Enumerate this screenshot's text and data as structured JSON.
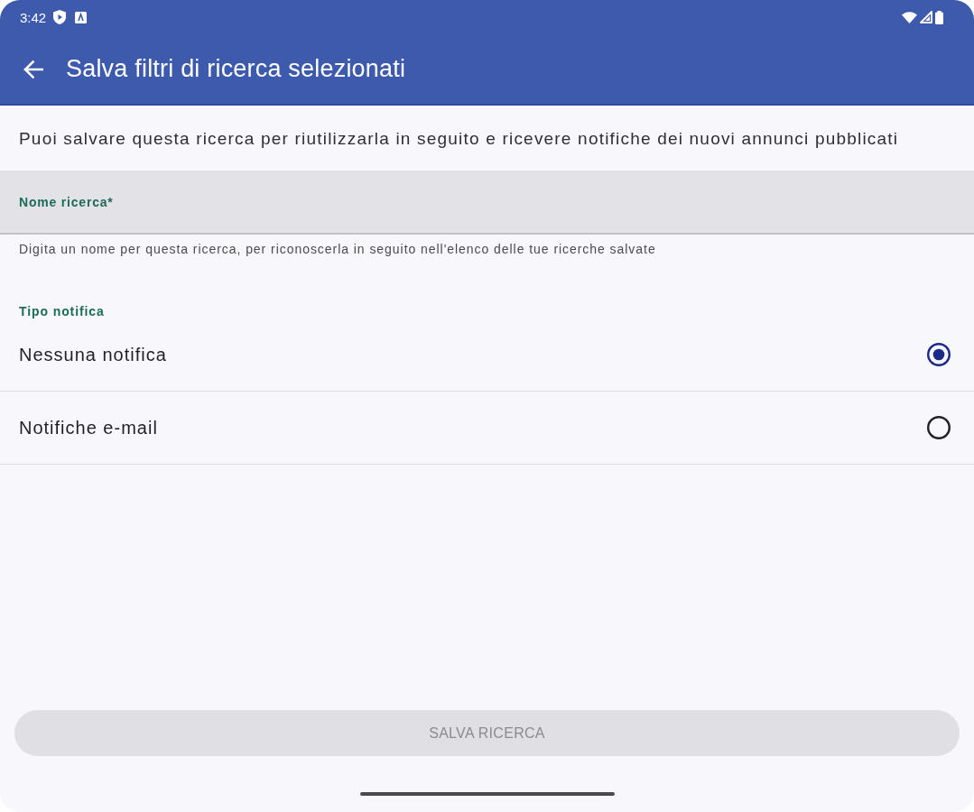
{
  "status_bar": {
    "time": "3:42"
  },
  "app_bar": {
    "title": "Salva filtri di ricerca selezionati"
  },
  "intro": "Puoi salvare questa ricerca per riutilizzarla in seguito e ricevere notifiche dei nuovi annunci pubblicati",
  "name_field": {
    "label": "Nome ricerca*",
    "helper": "Digita un nome per questa ricerca, per riconoscerla in seguito nell'elenco delle tue ricerche salvate"
  },
  "notification_type": {
    "label": "Tipo notifica",
    "options": [
      {
        "label": "Nessuna notifica",
        "selected": true
      },
      {
        "label": "Notifiche e-mail",
        "selected": false
      }
    ]
  },
  "save_button": {
    "label": "SALVA RICERCA",
    "disabled": true
  }
}
